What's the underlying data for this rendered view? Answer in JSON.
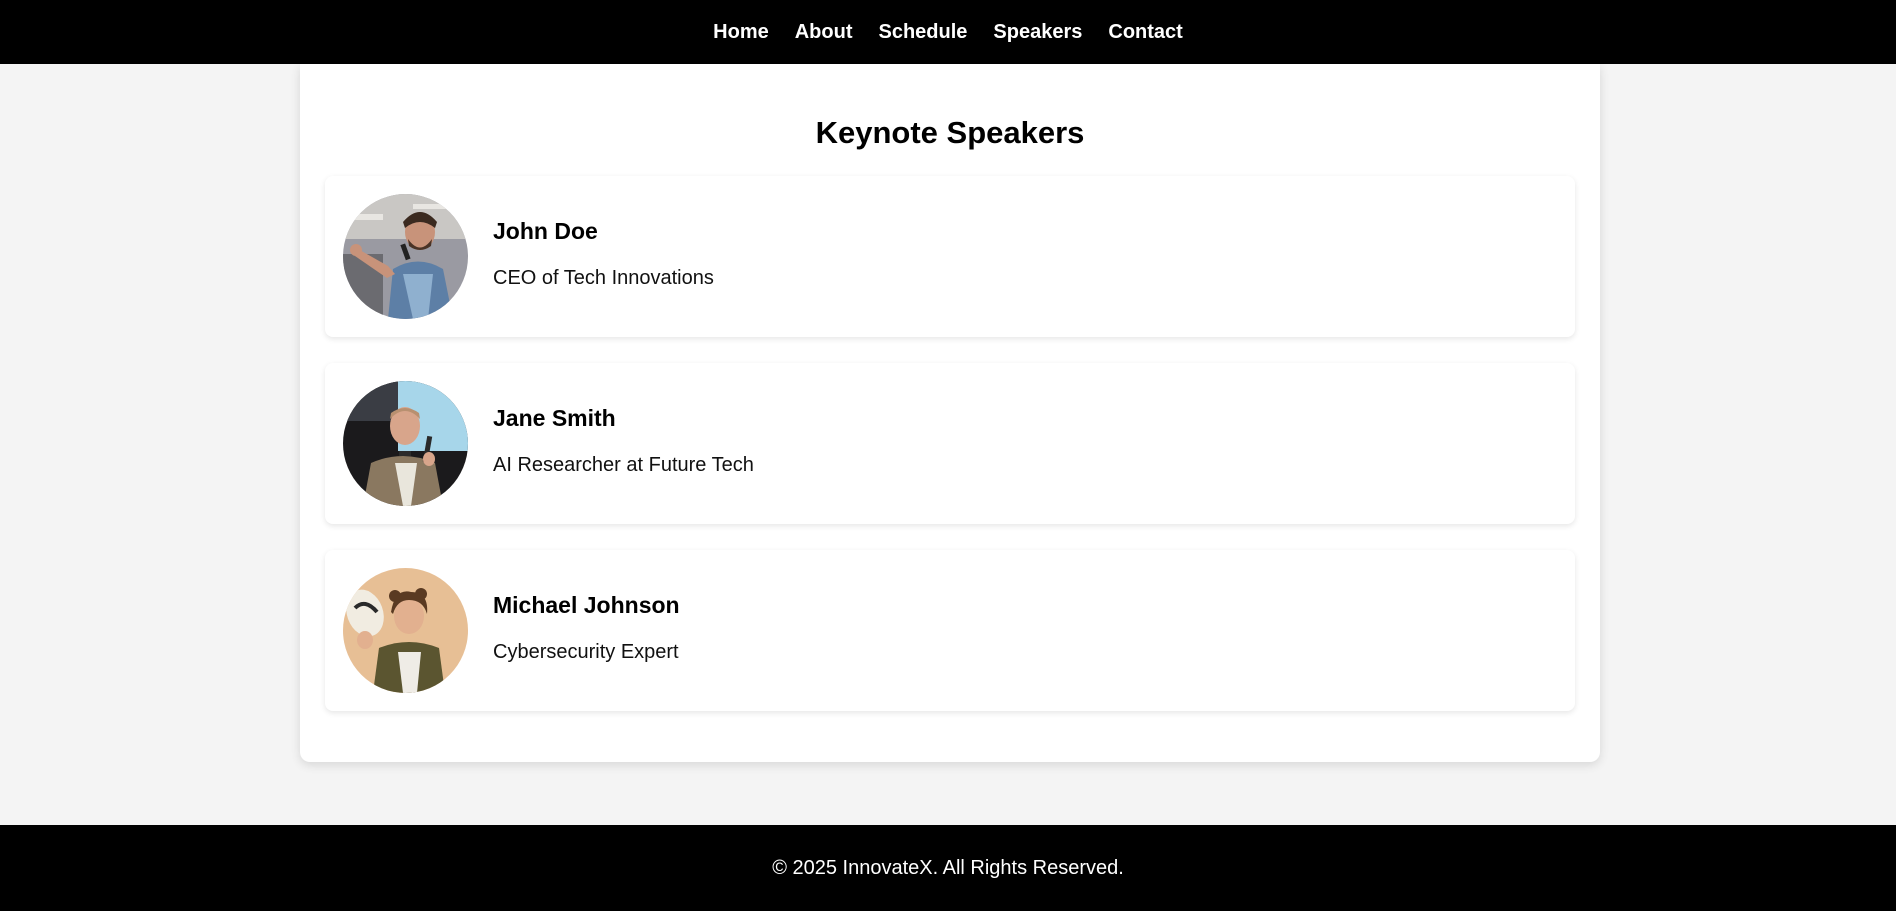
{
  "nav": {
    "items": [
      {
        "label": "Home"
      },
      {
        "label": "About"
      },
      {
        "label": "Schedule"
      },
      {
        "label": "Speakers"
      },
      {
        "label": "Contact"
      }
    ]
  },
  "main": {
    "title": "Keynote Speakers",
    "speakers": [
      {
        "name": "John Doe",
        "role": "CEO of Tech Innovations"
      },
      {
        "name": "Jane Smith",
        "role": "AI Researcher at Future Tech"
      },
      {
        "name": "Michael Johnson",
        "role": "Cybersecurity Expert"
      }
    ]
  },
  "footer": {
    "text": "© 2025 InnovateX. All Rights Reserved."
  },
  "colors": {
    "nav_bg": "#000000",
    "page_bg": "#f4f4f4",
    "card_bg": "#ffffff",
    "footer_bg": "#000000"
  }
}
